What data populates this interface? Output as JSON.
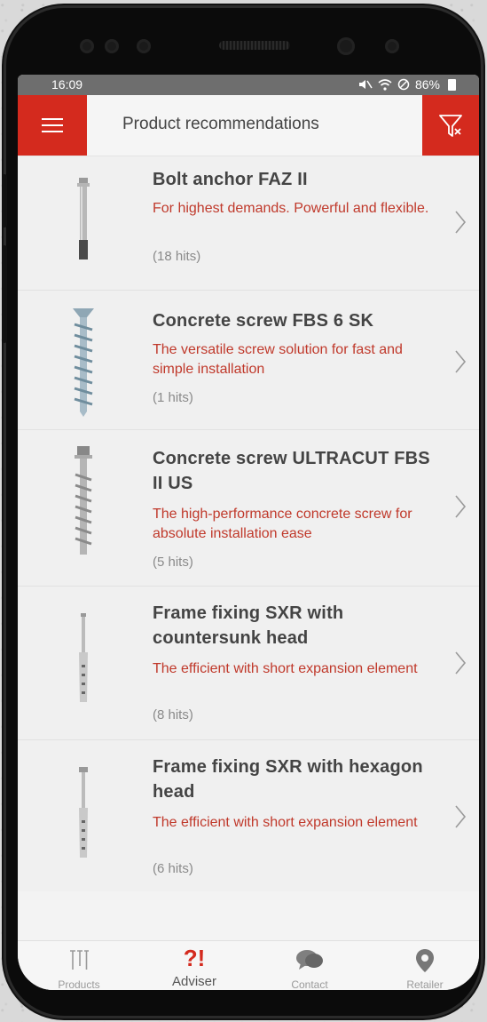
{
  "status_bar": {
    "time": "16:09",
    "battery": "86%"
  },
  "header": {
    "title": "Product recommendations",
    "accent_color": "#d42a1e"
  },
  "products": [
    {
      "title": "Bolt anchor FAZ II",
      "description": "For highest demands. Powerful and flexible.",
      "hits": "(18 hits)",
      "thumb_icon": "bolt-anchor-icon"
    },
    {
      "title": "Concrete screw FBS 6 SK",
      "description": "The versatile screw solution for fast and simple installation",
      "hits": "(1 hits)",
      "thumb_icon": "concrete-screw-icon"
    },
    {
      "title": "Concrete screw ULTRACUT FBS II US",
      "description": "The high-performance concrete screw for absolute installation ease",
      "hits": "(5 hits)",
      "thumb_icon": "ultracut-screw-icon"
    },
    {
      "title": "Frame fixing SXR with countersunk head",
      "description": "The efficient with short expansion element",
      "hits": "(8 hits)",
      "thumb_icon": "frame-fixing-icon"
    },
    {
      "title": "Frame fixing SXR with hexagon head",
      "description": "The efficient with short expansion element",
      "hits": "(6 hits)",
      "thumb_icon": "frame-fixing-hex-icon"
    }
  ],
  "tabs": [
    {
      "label": "Products",
      "icon": "products-icon"
    },
    {
      "label": "Adviser",
      "mark": "?!",
      "icon": "adviser-icon",
      "active": true
    },
    {
      "label": "Contact",
      "icon": "contact-icon"
    },
    {
      "label": "Retailer",
      "icon": "location-pin-icon"
    }
  ],
  "system_nav": {
    "recents_glyph": "|||",
    "home_glyph": "◯",
    "back_glyph": "<"
  }
}
